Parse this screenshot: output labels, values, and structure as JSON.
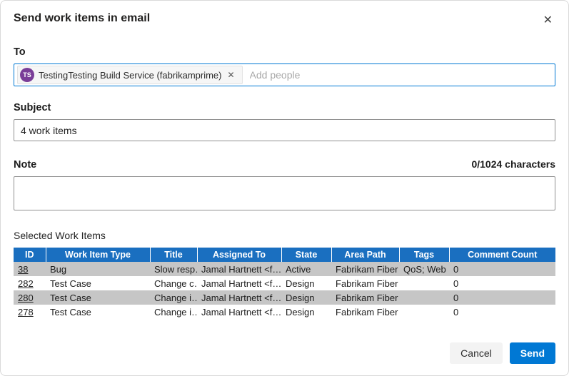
{
  "dialog": {
    "title": "Send work items in email"
  },
  "icons": {
    "close": "✕",
    "chip_remove": "✕"
  },
  "to": {
    "label": "To",
    "chip": {
      "avatar_initials": "TS",
      "text": "TestingTesting Build Service (fabrikamprime)"
    },
    "placeholder": "Add people"
  },
  "subject": {
    "label": "Subject",
    "value": "4 work items"
  },
  "note": {
    "label": "Note",
    "counter": "0/1024 characters"
  },
  "work_items": {
    "section_label": "Selected Work Items",
    "columns": [
      "ID",
      "Work Item Type",
      "Title",
      "Assigned To",
      "State",
      "Area Path",
      "Tags",
      "Comment Count"
    ],
    "rows": [
      {
        "id": "38",
        "type": "Bug",
        "title": "Slow resp…",
        "assigned_to": "Jamal Hartnett <f…",
        "state": "Active",
        "area_path": "Fabrikam Fiber",
        "tags": "QoS; Web",
        "comment_count": "0"
      },
      {
        "id": "282",
        "type": "Test Case",
        "title": "Change c…",
        "assigned_to": "Jamal Hartnett <f…",
        "state": "Design",
        "area_path": "Fabrikam Fiber",
        "tags": "",
        "comment_count": "0"
      },
      {
        "id": "280",
        "type": "Test Case",
        "title": "Change i…",
        "assigned_to": "Jamal Hartnett <f…",
        "state": "Design",
        "area_path": "Fabrikam Fiber",
        "tags": "",
        "comment_count": "0"
      },
      {
        "id": "278",
        "type": "Test Case",
        "title": "Change i…",
        "assigned_to": "Jamal Hartnett <f…",
        "state": "Design",
        "area_path": "Fabrikam Fiber",
        "tags": "",
        "comment_count": "0"
      }
    ]
  },
  "footer": {
    "cancel_label": "Cancel",
    "send_label": "Send"
  },
  "colors": {
    "accent": "#0078d4",
    "table_header": "#1a6fc0",
    "row_alt": "#c6c6c6",
    "avatar": "#7a3e98"
  }
}
